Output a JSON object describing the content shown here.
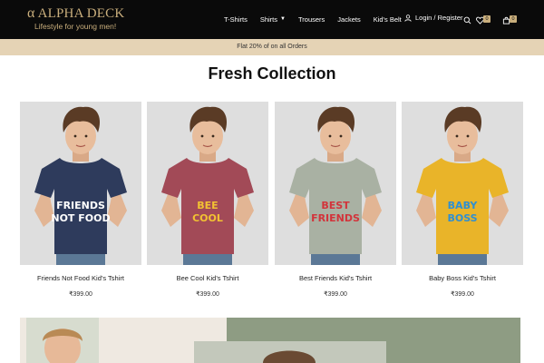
{
  "brand": {
    "alpha_glyph": "α",
    "name": "ALPHA DECK",
    "tagline": "Lifestyle for young men!"
  },
  "nav": {
    "items": [
      {
        "label": "T-Shirts"
      },
      {
        "label": "Shirts"
      },
      {
        "label": "Trousers"
      },
      {
        "label": "Jackets"
      },
      {
        "label": "Kid's Belt"
      }
    ],
    "login_label": "Login / Register",
    "wishlist_count": "0",
    "cart_count": "0"
  },
  "promo": {
    "text": "Flat 20% of on all Orders"
  },
  "section": {
    "title": "Fresh Collection"
  },
  "products": [
    {
      "name": "Friends Not Food Kid's Tshirt",
      "price": "₹399.00",
      "shirt_color": "#2e3b5c",
      "print": [
        "FRIENDS",
        "NOT FOOD"
      ],
      "print_color": "#ffffff"
    },
    {
      "name": "Bee Cool Kid's Tshirt",
      "price": "₹399.00",
      "shirt_color": "#a24a57",
      "print": [
        "BEE",
        "COOL"
      ],
      "print_color": "#f2c232"
    },
    {
      "name": "Best Friends Kid's Tshirt",
      "price": "₹399.00",
      "shirt_color": "#a9b1a3",
      "print": [
        "BEST",
        "FRIENDS"
      ],
      "print_color": "#d2343b"
    },
    {
      "name": "Baby Boss Kid's Tshirt",
      "price": "₹399.00",
      "shirt_color": "#e9b429",
      "print": [
        "BABY",
        "BOSS"
      ],
      "print_color": "#2f8fd1"
    }
  ],
  "colors": {
    "header_bg": "#0a0a0a",
    "brand_gold": "#c9ae7c",
    "promo_bg": "#e5d3b5"
  }
}
